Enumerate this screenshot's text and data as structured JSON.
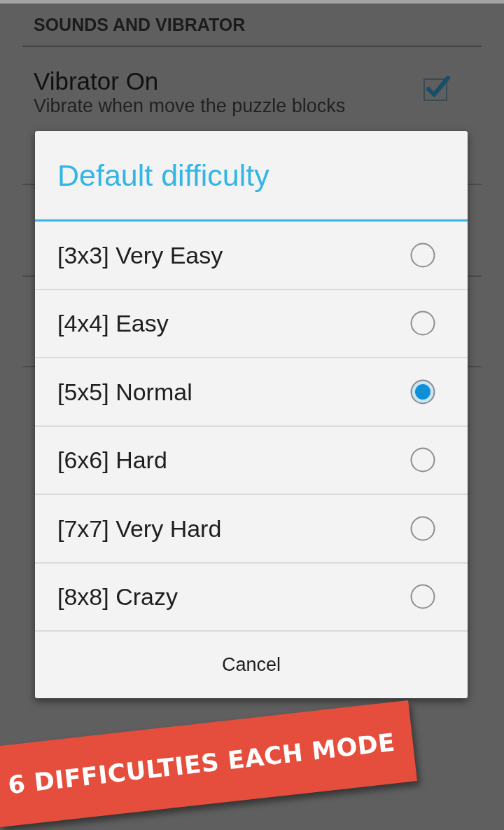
{
  "background": {
    "section_header": "SOUNDS AND VIBRATOR",
    "setting": {
      "title": "Vibrator On",
      "summary": "Vibrate when move the puzzle blocks",
      "checked": true
    }
  },
  "dialog": {
    "title": "Default difficulty",
    "options": [
      {
        "label": "[3x3] Very Easy",
        "selected": false
      },
      {
        "label": "[4x4] Easy",
        "selected": false
      },
      {
        "label": "[5x5] Normal",
        "selected": true
      },
      {
        "label": "[6x6] Hard",
        "selected": false
      },
      {
        "label": "[7x7] Very Hard",
        "selected": false
      },
      {
        "label": "[8x8] Crazy",
        "selected": false
      }
    ],
    "cancel": "Cancel"
  },
  "banner": {
    "text": "6 DIFFICULTIES EACH MODE"
  }
}
